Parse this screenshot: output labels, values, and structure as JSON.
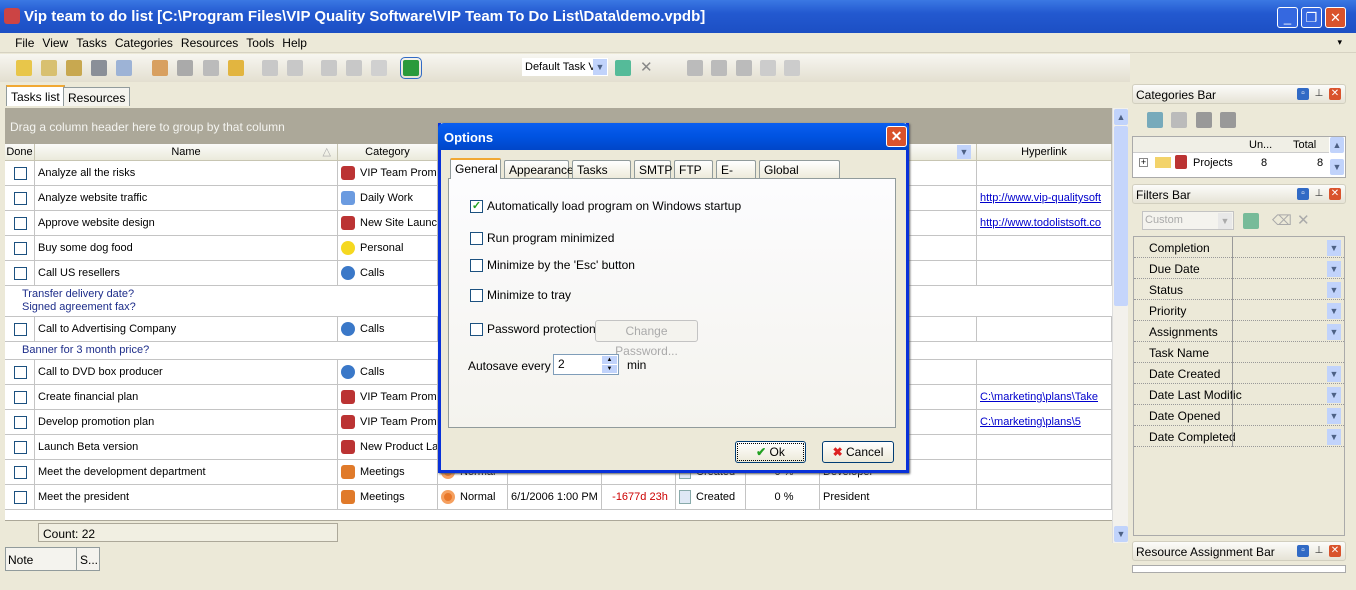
{
  "window": {
    "title": "Vip team to do list [C:\\Program Files\\VIP Quality Software\\VIP Team To Do List\\Data\\demo.vpdb]",
    "minimize": "_",
    "restore": "❐",
    "close": "✕"
  },
  "menu": [
    "File",
    "View",
    "Tasks",
    "Categories",
    "Resources",
    "Tools",
    "Help"
  ],
  "toolbar": {
    "view_select": "Default Task V"
  },
  "tabs": [
    "Tasks list",
    "Resources"
  ],
  "group_hint": "Drag a column header here to group by that column",
  "columns": {
    "done": "Done",
    "name": "Name",
    "category": "Category",
    "hyperlink": "Hyperlink"
  },
  "rows": [
    {
      "type": "task",
      "name": "Analyze all the risks",
      "category": "VIP Team Promo",
      "cat_icon": "project-icon"
    },
    {
      "type": "task",
      "name": "Analyze website traffic",
      "category": "Daily Work",
      "cat_icon": "daily-work-icon",
      "hyperlink": "http://www.vip-qualitysoft"
    },
    {
      "type": "task",
      "name": "Approve website design",
      "category": "New Site Launc",
      "cat_icon": "project-icon",
      "hyperlink": "http://www.todolistsoft.co"
    },
    {
      "type": "task",
      "name": "Buy some dog food",
      "category": "Personal",
      "cat_icon": "smiley-icon"
    },
    {
      "type": "task",
      "name": "Call US resellers",
      "category": "Calls",
      "cat_icon": "stopwatch-icon"
    },
    {
      "type": "note",
      "lines": [
        "Transfer delivery date?",
        "Signed agreement fax?"
      ]
    },
    {
      "type": "task",
      "name": "Call to Advertising Company",
      "category": "Calls",
      "cat_icon": "stopwatch-icon"
    },
    {
      "type": "note",
      "lines": [
        "Banner for 3 month price?"
      ]
    },
    {
      "type": "task",
      "name": "Call to DVD box producer",
      "category": "Calls",
      "cat_icon": "stopwatch-icon"
    },
    {
      "type": "task",
      "name": "Create financial plan",
      "category": "VIP Team Promo",
      "cat_icon": "project-icon",
      "hyperlink": "C:\\marketing\\plans\\Take "
    },
    {
      "type": "task",
      "name": "Develop promotion plan",
      "category": "VIP Team Promo",
      "cat_icon": "project-icon",
      "hyperlink": "C:\\marketing\\plans\\5 "
    },
    {
      "type": "task",
      "name": "Launch Beta version",
      "category": "New Product La",
      "cat_icon": "project-icon"
    },
    {
      "type": "task",
      "name": "Meet the development department",
      "category": "Meetings",
      "cat_icon": "meetings-icon",
      "priority": "Normal",
      "status": "Created",
      "completion": "0 %",
      "resource": "Developer"
    },
    {
      "type": "task",
      "name": "Meet the president",
      "category": "Meetings",
      "cat_icon": "meetings-icon",
      "priority": "Normal",
      "due": "6/1/2006 1:00 PM",
      "left": "-1677d 23h",
      "status": "Created",
      "completion": "0 %",
      "resource": "President"
    }
  ],
  "footer": {
    "count": "Count: 22"
  },
  "bottom_tabs": [
    "Note",
    "S..."
  ],
  "categories_bar": {
    "title": "Categories Bar",
    "col_unread": "Un...",
    "col_total": "Total",
    "items": [
      {
        "name": "Projects",
        "unread": "8",
        "total": "8"
      }
    ]
  },
  "filters_bar": {
    "title": "Filters Bar",
    "preset": "Custom",
    "fields": [
      "Completion",
      "Due Date",
      "Status",
      "Priority",
      "Assignments",
      "Task Name",
      "Date Created",
      "Date Last Modific",
      "Date Opened",
      "Date Completed"
    ],
    "no_dropdown": [
      "Task Name"
    ]
  },
  "resource_bar": {
    "title": "Resource Assignment Bar"
  },
  "dialog": {
    "title": "Options",
    "tabs": [
      "General",
      "Appearance",
      "Tasks List",
      "SMTP",
      "FTP",
      "E-Mail",
      "Global Hotkeys"
    ],
    "active_tab": "General",
    "options": [
      {
        "label": "Automatically load program on Windows startup",
        "checked": true
      },
      {
        "label": "Run program minimized",
        "checked": false
      },
      {
        "label": "Minimize by the 'Esc' button",
        "checked": false
      },
      {
        "label": "Minimize to tray",
        "checked": false
      },
      {
        "label": "Password protection",
        "checked": false
      }
    ],
    "change_password": "Change Password...",
    "autosave_label": "Autosave every",
    "autosave_value": "2",
    "autosave_unit": "min",
    "ok": "Ok",
    "cancel": "Cancel"
  },
  "colors": {
    "titlebar": "#2359d0",
    "dialog_border": "#0831d9",
    "link": "#0000cc",
    "overdue": "#cc0000",
    "note": "#1d2d8a"
  }
}
